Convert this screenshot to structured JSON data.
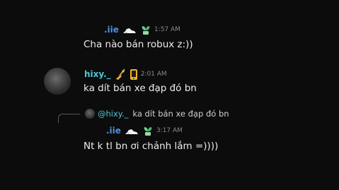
{
  "messages": [
    {
      "username": ".iie",
      "username_color": "#4f8fe0",
      "timestamp": "1:57 AM",
      "text": "Cha nào bán robux z:))",
      "badges": [
        "cloud-icon",
        "plant-icon"
      ]
    },
    {
      "username": "hixy._",
      "username_color": "#4dc7d6",
      "timestamp": "2:01 AM",
      "text": "ka dít bán xe đạp đó bn",
      "badges": [
        "broom-icon",
        "phone-icon"
      ]
    },
    {
      "username": ".iie",
      "username_color": "#4f8fe0",
      "timestamp": "3:17 AM",
      "text": "Nt k tl bn ơi chảnh lắm =))))",
      "badges": [
        "cloud-icon",
        "plant-icon"
      ],
      "reply": {
        "mention": "@hixy._",
        "text": "ka dít bán xe đạp đó bn"
      }
    }
  ]
}
